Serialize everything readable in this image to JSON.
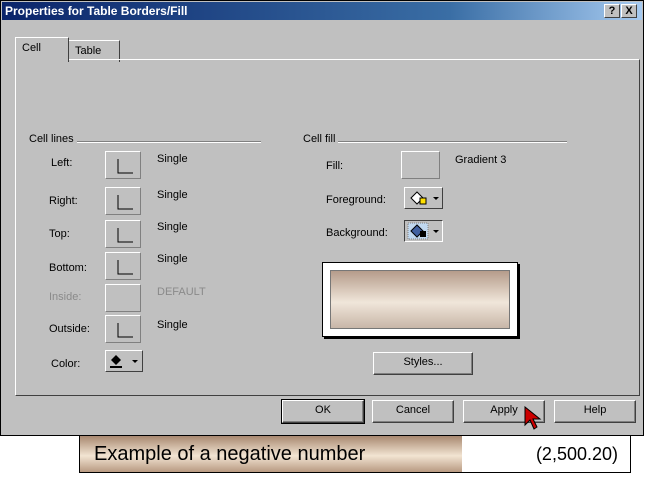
{
  "window": {
    "title": "Properties for Table Borders/Fill",
    "help_glyph": "?",
    "close_glyph": "X"
  },
  "tabs": [
    {
      "label": "Cell"
    },
    {
      "label": "Table"
    }
  ],
  "cell_lines": {
    "title": "Cell lines",
    "rows": [
      {
        "label": "Left:",
        "value": "Single",
        "enabled": true
      },
      {
        "label": "Right:",
        "value": "Single",
        "enabled": true
      },
      {
        "label": "Top:",
        "value": "Single",
        "enabled": true
      },
      {
        "label": "Bottom:",
        "value": "Single",
        "enabled": true
      },
      {
        "label": "Inside:",
        "value": "DEFAULT",
        "enabled": false
      },
      {
        "label": "Outside:",
        "value": "Single",
        "enabled": true
      }
    ],
    "color_label": "Color:"
  },
  "cell_fill": {
    "title": "Cell fill",
    "fill_label": "Fill:",
    "fill_value": "Gradient 3",
    "foreground_label": "Foreground:",
    "background_label": "Background:",
    "styles_button": "Styles..."
  },
  "buttons": {
    "ok": "OK",
    "cancel": "Cancel",
    "apply": "Apply",
    "help": "Help"
  },
  "example": {
    "label": "Example of a negative number",
    "value": "(2,500.20)"
  },
  "icons": {
    "line_style": "corner-line-icon",
    "color": "bucket-fill-icon",
    "foreground": "fill-pattern-icon",
    "background": "fill-pattern-icon",
    "cursor": "mouse-pointer-icon"
  },
  "colors": {
    "title_bar": "#0a246a",
    "dialog": "#c0c0c0",
    "cursor": "#cc0000"
  }
}
